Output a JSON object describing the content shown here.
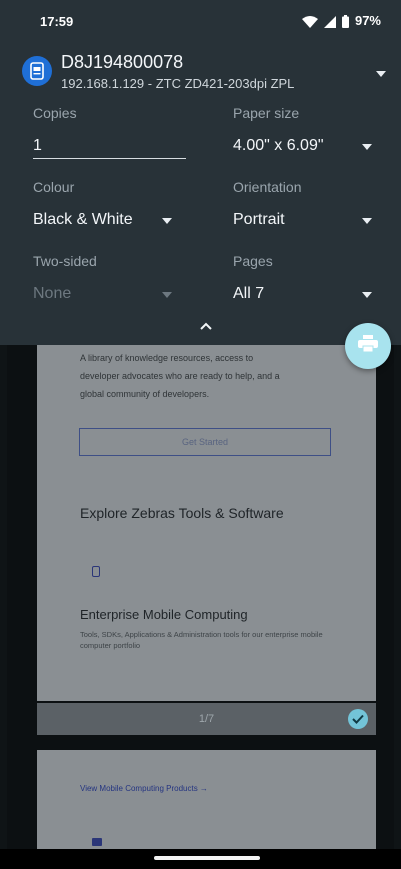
{
  "status_bar": {
    "time": "17:59",
    "battery": "97%"
  },
  "printer": {
    "name": "D8J194800078",
    "details": "192.168.1.129 - ZTC ZD421-203dpi ZPL"
  },
  "options": {
    "copies": {
      "label": "Copies",
      "value": "1"
    },
    "paper_size": {
      "label": "Paper size",
      "value": "4.00\" x 6.09\""
    },
    "colour": {
      "label": "Colour",
      "value": "Black & White"
    },
    "orientation": {
      "label": "Orientation",
      "value": "Portrait"
    },
    "two_sided": {
      "label": "Two-sided",
      "value": "None"
    },
    "pages": {
      "label": "Pages",
      "value": "All 7"
    }
  },
  "preview": {
    "page1": {
      "intro": "A library of knowledge resources, access to developer advocates who are ready to help, and a global community of developers.",
      "button": "Get Started",
      "heading": "Explore Zebras Tools & Software",
      "subheading": "Enterprise Mobile Computing",
      "description": "Tools, SDKs, Applications & Administration tools for our enterprise mobile computer portfolio"
    },
    "page_indicator": "1/7",
    "page2": {
      "link": "View Mobile Computing Products →"
    }
  },
  "colors": {
    "panel": "#283238",
    "fab": "#a8e3ee",
    "accent_blue": "#1f6fd6"
  }
}
